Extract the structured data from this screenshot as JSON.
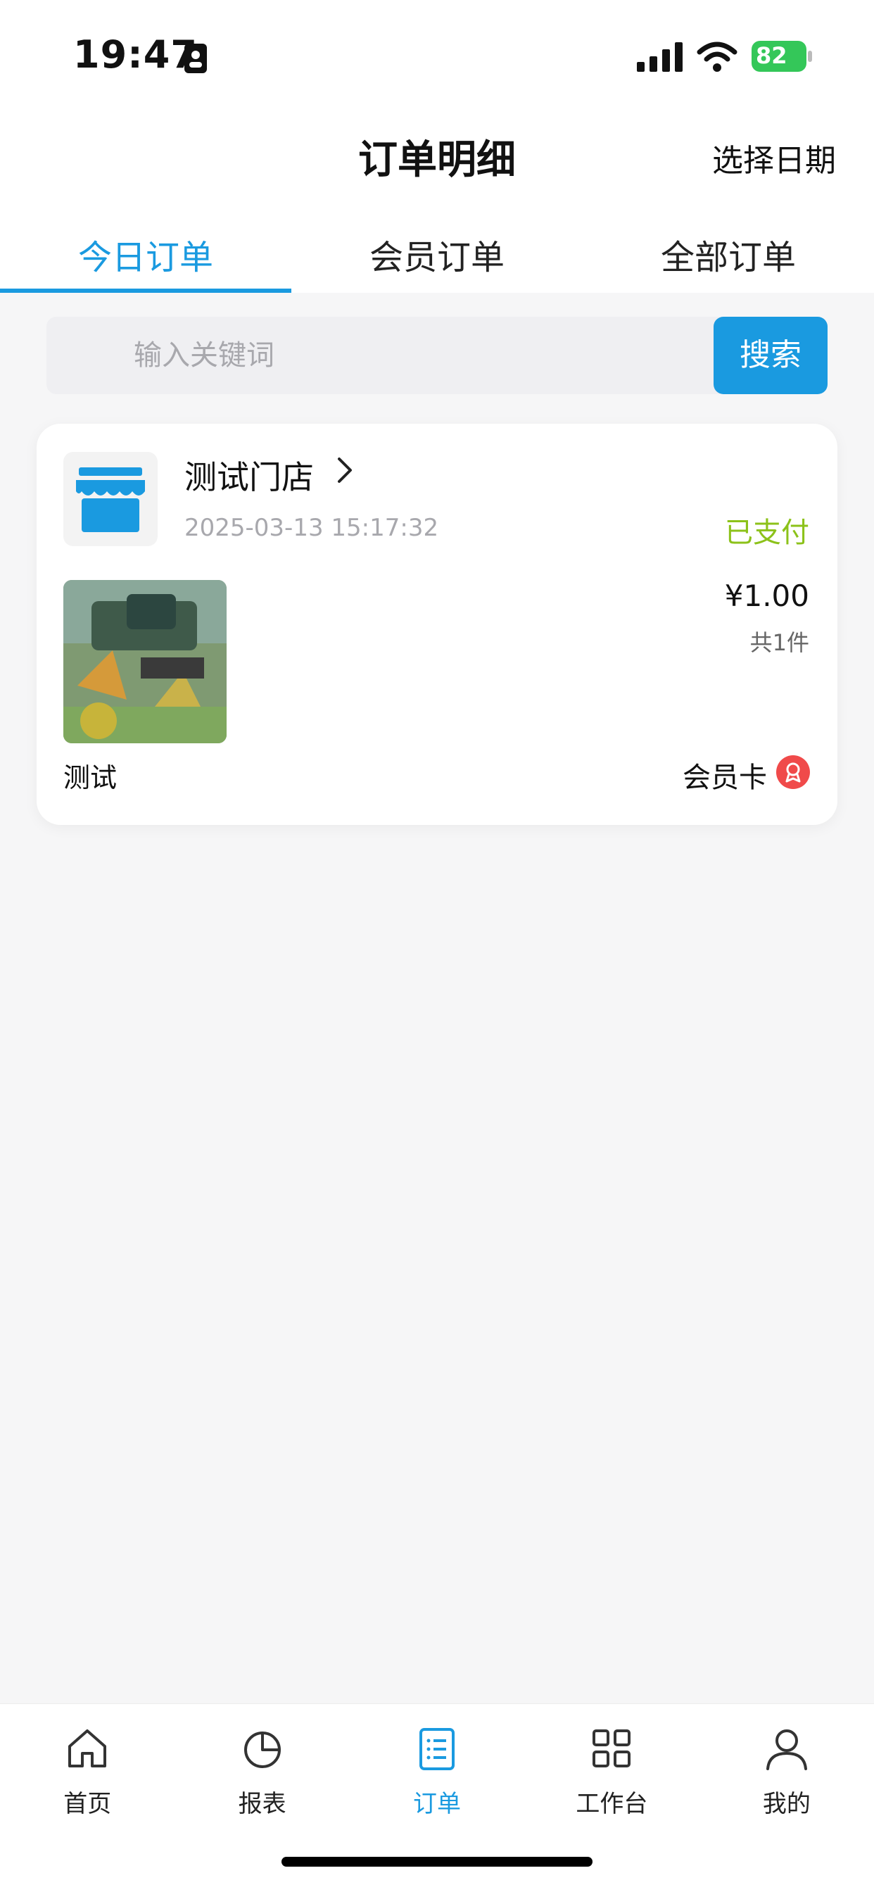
{
  "status_bar": {
    "time": "19:47",
    "battery": "82"
  },
  "nav": {
    "title": "订单明细",
    "right_action": "选择日期"
  },
  "tabs": [
    {
      "label": "今日订单",
      "active": true
    },
    {
      "label": "会员订单",
      "active": false
    },
    {
      "label": "全部订单",
      "active": false
    }
  ],
  "search": {
    "placeholder": "输入关键词",
    "value": "",
    "button_label": "搜索"
  },
  "orders": [
    {
      "store_name": "测试门店",
      "time": "2025-03-13 15:17:32",
      "status": "已支付",
      "price": "¥1.00",
      "count": "共1件",
      "product_name": "测试",
      "payment_method": "会员卡"
    }
  ],
  "tabbar": [
    {
      "label": "首页",
      "icon": "home-icon",
      "active": false
    },
    {
      "label": "报表",
      "icon": "pie-chart-icon",
      "active": false
    },
    {
      "label": "订单",
      "icon": "list-icon",
      "active": true
    },
    {
      "label": "工作台",
      "icon": "grid-icon",
      "active": false
    },
    {
      "label": "我的",
      "icon": "user-icon",
      "active": false
    }
  ],
  "colors": {
    "accent": "#1a9ae0",
    "paid": "#8cc21a",
    "battery": "#34c759",
    "member_badge": "#f04a4a"
  }
}
